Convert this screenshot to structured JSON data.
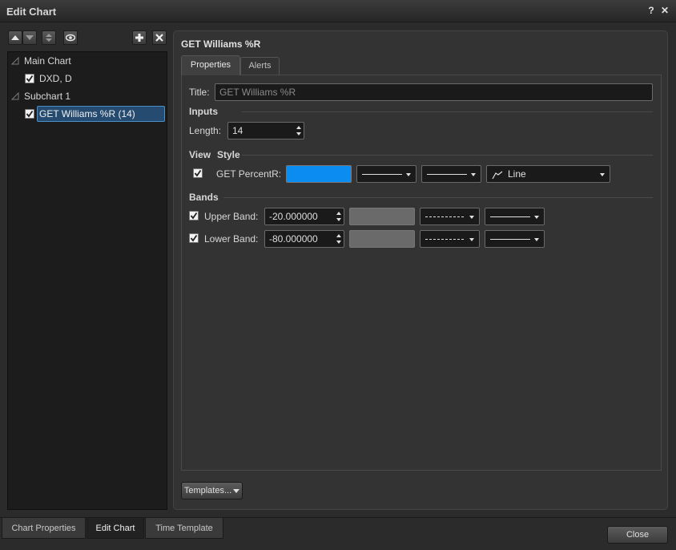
{
  "window": {
    "title": "Edit Chart",
    "help_glyph": "?",
    "close_glyph": "✕"
  },
  "tree": {
    "main_chart": "Main Chart",
    "dxd": "DXD, D",
    "subchart": "Subchart 1",
    "williams": "GET Williams %R (14)"
  },
  "panel": {
    "title": "GET Williams %R",
    "tabs": [
      "Properties",
      "Alerts"
    ]
  },
  "props": {
    "title_label": "Title:",
    "title_placeholder": "GET Williams %R",
    "inputs_heading": "Inputs",
    "length_label": "Length:",
    "length_value": "14",
    "view_heading": "View",
    "style_heading": "Style",
    "percentr_label": "GET PercentR:",
    "percentr_color": "#0a8cf0",
    "line_type": "Line",
    "bands_heading": "Bands",
    "upper_label": "Upper Band:",
    "upper_value": "-20.000000",
    "lower_label": "Lower Band:",
    "lower_value": "-80.000000",
    "band_color": "#6a6a6a"
  },
  "templates_button": "Templates...",
  "bottom_tabs": [
    "Chart Properties",
    "Edit Chart",
    "Time Template"
  ],
  "close_button": "Close"
}
